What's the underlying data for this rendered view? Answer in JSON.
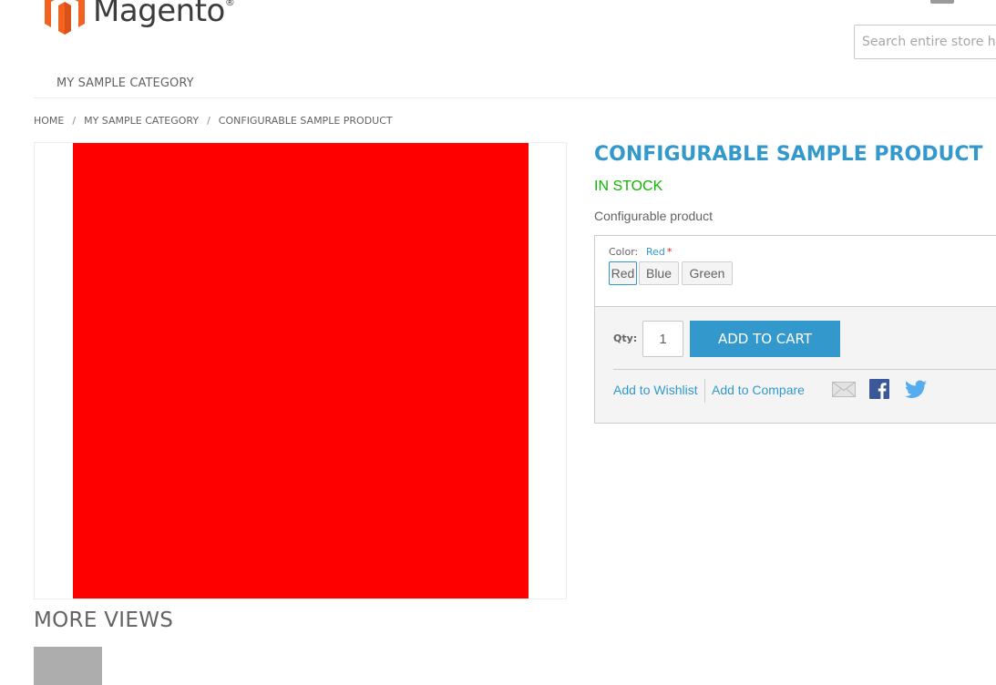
{
  "header": {
    "logo_text": "Magento",
    "logo_reg": "®",
    "search_placeholder": "Search entire store here...",
    "search_value": ""
  },
  "nav": {
    "items": [
      {
        "label": "MY SAMPLE CATEGORY"
      }
    ]
  },
  "breadcrumb": {
    "items": [
      {
        "label": "HOME"
      },
      {
        "label": "MY SAMPLE CATEGORY"
      },
      {
        "label": "CONFIGURABLE SAMPLE PRODUCT"
      }
    ],
    "separator": "/"
  },
  "product": {
    "image_color": "#ff0000",
    "title": "CONFIGURABLE SAMPLE PRODUCT",
    "stock": "IN STOCK",
    "description": "Configurable product",
    "option": {
      "label": "Color:",
      "selected": "Red",
      "required_mark": "*",
      "swatches": [
        {
          "label": "Red",
          "selected": true
        },
        {
          "label": "Blue",
          "selected": false
        },
        {
          "label": "Green",
          "selected": false
        }
      ]
    },
    "qty_label": "Qty:",
    "qty_value": "1",
    "add_to_cart": "ADD TO CART",
    "links": {
      "wishlist": "Add to Wishlist",
      "compare": "Add to Compare"
    },
    "share_icons": [
      "email-icon",
      "facebook-icon",
      "twitter-icon"
    ]
  },
  "more_views": {
    "title": "MORE VIEWS"
  },
  "colors": {
    "accent": "#3399cc",
    "in_stock": "#11b400",
    "logo_orange": "#f26322",
    "facebook": "#3b5998",
    "twitter": "#55acee"
  }
}
